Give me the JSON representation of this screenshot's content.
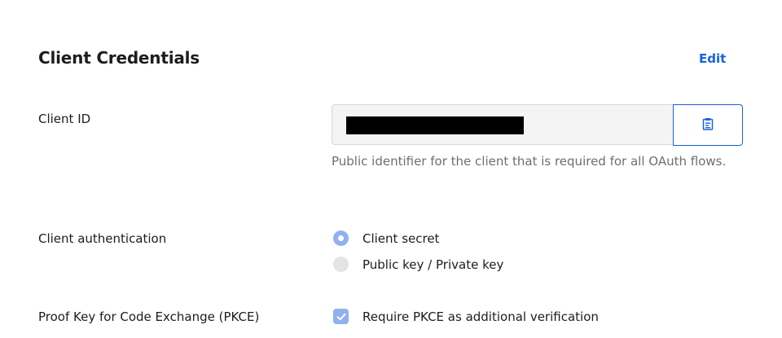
{
  "section": {
    "title": "Client Credentials",
    "edit_label": "Edit"
  },
  "client_id": {
    "label": "Client ID",
    "value": "",
    "help_text": "Public identifier for the client that is required for all OAuth flows.",
    "copy_icon": "clipboard-copy-icon"
  },
  "client_authentication": {
    "label": "Client authentication",
    "options": [
      {
        "label": "Client secret",
        "selected": true
      },
      {
        "label": "Public key / Private key",
        "selected": false
      }
    ]
  },
  "pkce": {
    "label": "Proof Key for Code Exchange (PKCE)",
    "checkbox_label": "Require PKCE as additional verification",
    "checked": true
  },
  "colors": {
    "accent": "#1662dd",
    "control_fill": "#8fb1ef",
    "muted_text": "#6e6e78",
    "field_background": "#f4f4f4"
  }
}
